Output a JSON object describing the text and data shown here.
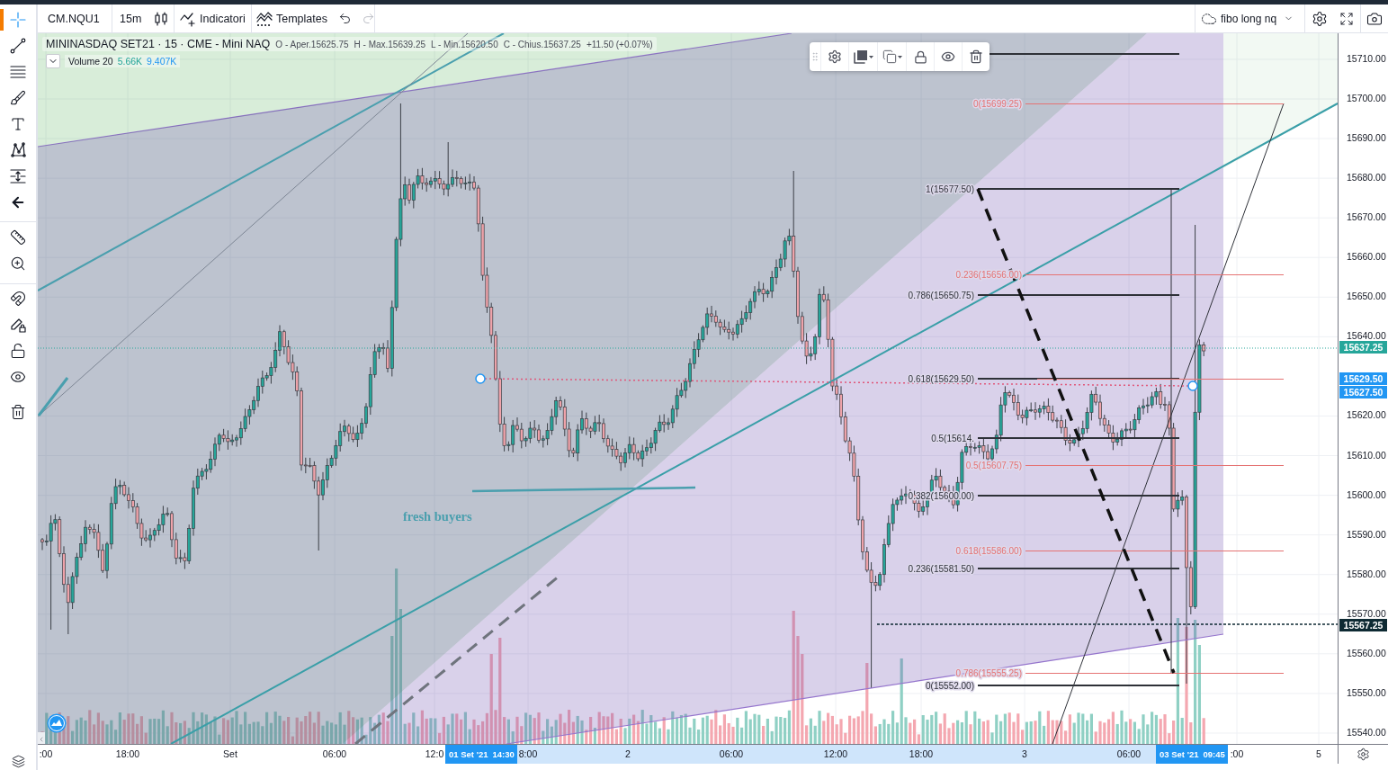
{
  "top_toolbar": {
    "symbol": "CM.NQU1",
    "interval": "15m",
    "indicators": "Indicatori",
    "templates": "Templates",
    "undo": {
      "disabled": false
    },
    "redo": {
      "disabled": true
    },
    "layout": "fibo long nq"
  },
  "drawing_tools": [
    {
      "selected": true
    },
    {
      "selected": false
    },
    {
      "selected": false
    },
    {
      "selected": false
    },
    {
      "selected": false
    },
    {
      "selected": false
    },
    {
      "selected": false
    },
    {
      "selected": false
    }
  ],
  "legend": {
    "title": "MININASDAQ SET21 · 15 · CME - Mini NAQ",
    "ohlc": [
      "O - Aper.15625.75",
      "H - Max.15639.25",
      "L - Min.15620.50",
      "C - Chius.15637.25",
      "+11.50 (+0.07%)"
    ],
    "volume": {
      "label": "Volume 20",
      "values": [
        {
          "text": "5.66K",
          "color": "#26a69a"
        },
        {
          "text": "9.407K",
          "color": "#2196f3"
        }
      ]
    }
  },
  "chart": {
    "annotation": "fresh buyers",
    "fibs": [
      {
        "color": "#2e3138",
        "labels": [
          "1(15677.50)",
          "0.786(15650.75)",
          "0.618(15629.50)",
          "0.5(15614.",
          "0.382(15600.00)",
          "0.236(15581.50)",
          "0(15552.00)"
        ]
      },
      {
        "color": "#e57373",
        "labels": [
          "0(15699.25)",
          "0.236(15656.00)",
          "0.5(15607.75)",
          "0.618(15586.00)",
          "0.786(15555.25)"
        ]
      }
    ]
  },
  "price_axis": {
    "ticks": [
      "15710.00",
      "15700.00",
      "15690.00",
      "15680.00",
      "15670.00",
      "15660.00",
      "15650.00",
      "15640.00",
      "15620.00",
      "15610.00",
      "15600.00",
      "15590.00",
      "15580.00",
      "15570.00",
      "15560.00",
      "15550.00",
      "15540.00"
    ],
    "tags": [
      {
        "text": "15637.25",
        "color": "#26a69a"
      },
      {
        "text": "15629.50",
        "color": "#2196f3"
      },
      {
        "text": "15627.50",
        "color": "#2196f3"
      },
      {
        "text": "15567.25",
        "color": "#0e2a33"
      }
    ]
  },
  "time_axis": {
    "ticks": [
      ":00",
      "18:00",
      "Set",
      "06:00",
      "12:0",
      "8:00",
      "2",
      "06:00",
      "12:00",
      "18:00",
      "3",
      "06:00",
      ":00",
      "5"
    ],
    "markers": [
      {
        "date": "01 Set '21",
        "time": "14:30"
      },
      {
        "date": "03 Set '21",
        "time": "09:45"
      }
    ]
  }
}
